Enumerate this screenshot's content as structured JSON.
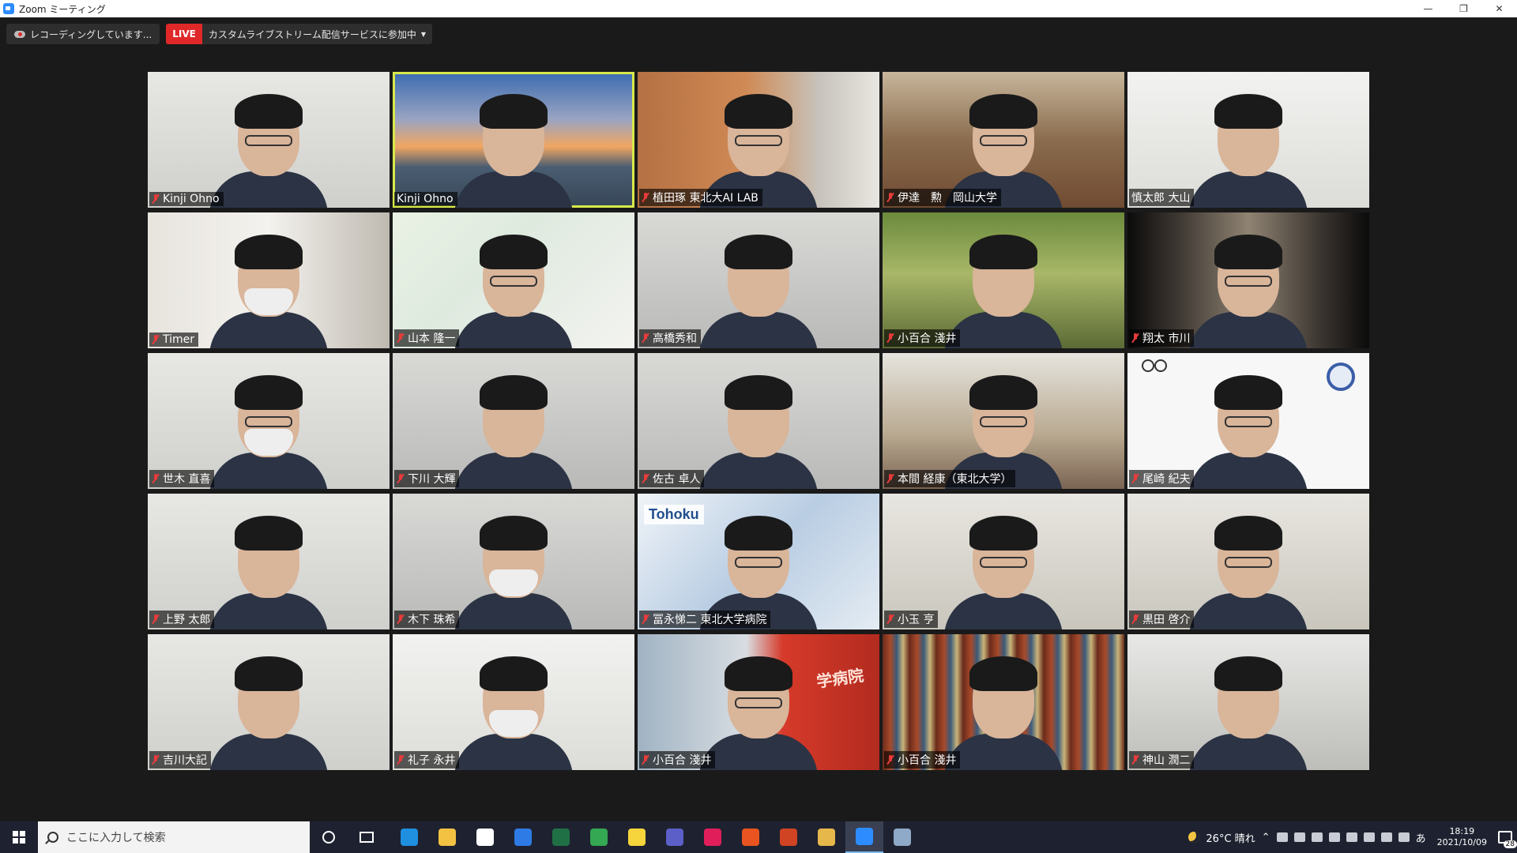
{
  "window": {
    "title": "Zoom ミーティング"
  },
  "topbar": {
    "recording_label": "レコーディングしています...",
    "live_badge": "LIVE",
    "live_label": "カスタムライブストリーム配信サービスに参加中"
  },
  "participants": [
    {
      "name": "Kinji Ohno",
      "bg": "bg-office-white",
      "muted": true,
      "glasses": true
    },
    {
      "name": "Kinji Ohno",
      "bg": "bg-bridge",
      "muted": false,
      "active": true
    },
    {
      "name": "植田琢 東北大AI LAB",
      "bg": "bg-orange-wall",
      "muted": true,
      "glasses": true
    },
    {
      "name": "伊達　勲　岡山大学",
      "bg": "bg-lecture",
      "muted": true,
      "glasses": true
    },
    {
      "name": "慎太郎 大山",
      "bg": "bg-white",
      "muted": false
    },
    {
      "name": "Timer",
      "bg": "bg-shelf",
      "muted": true,
      "mask": true
    },
    {
      "name": "山本 隆一",
      "bg": "bg-slide",
      "muted": true,
      "glasses": true
    },
    {
      "name": "高橋秀和",
      "bg": "bg-office-grey",
      "muted": true
    },
    {
      "name": "小百合 淺井",
      "bg": "bg-trees",
      "muted": true
    },
    {
      "name": "翔太 市川",
      "bg": "bg-bookshelf-dark",
      "muted": true,
      "glasses": true
    },
    {
      "name": "世木 直喜",
      "bg": "bg-office-white",
      "muted": true,
      "glasses": true,
      "mask": true
    },
    {
      "name": "下川 大輝",
      "bg": "bg-office-grey",
      "muted": true
    },
    {
      "name": "佐古 卓人",
      "bg": "bg-office-grey",
      "muted": true
    },
    {
      "name": "本間 経康（東北大学）",
      "bg": "bg-classroom",
      "muted": true,
      "glasses": true
    },
    {
      "name": "尾崎 紀夫",
      "bg": "bg-logo-white",
      "muted": true,
      "glasses": true,
      "logo": true
    },
    {
      "name": "上野 太郎",
      "bg": "bg-office-white",
      "muted": true
    },
    {
      "name": "木下 珠希",
      "bg": "bg-office-grey",
      "muted": true,
      "mask": true
    },
    {
      "name": "冨永悌二 東北大学病院",
      "bg": "bg-hospital",
      "muted": true,
      "glasses": true,
      "tohoku": true
    },
    {
      "name": "小玉 亨",
      "bg": "bg-office-light",
      "muted": true,
      "glasses": true
    },
    {
      "name": "黒田 啓介",
      "bg": "bg-office-light",
      "muted": true,
      "glasses": true
    },
    {
      "name": "吉川大記",
      "bg": "bg-office-white",
      "muted": true
    },
    {
      "name": "礼子 永井",
      "bg": "bg-white",
      "muted": true,
      "mask": true
    },
    {
      "name": "小百合 淺井",
      "bg": "bg-hospital-red",
      "muted": true,
      "glasses": true,
      "sign": true
    },
    {
      "name": "小百合 淺井",
      "bg": "bg-library",
      "muted": true
    },
    {
      "name": "神山 潤二",
      "bg": "bg-ceiling",
      "muted": true
    }
  ],
  "tohoku_logo": "Tohoku",
  "hospital_sign": "学病院",
  "taskbar": {
    "search_placeholder": "ここに入力して検索",
    "apps": [
      {
        "name": "edge-icon",
        "color": "#1f8fe0"
      },
      {
        "name": "file-explorer-icon",
        "color": "#f3c243"
      },
      {
        "name": "store-icon",
        "color": "#ffffff"
      },
      {
        "name": "mail-icon",
        "color": "#2f7be5"
      },
      {
        "name": "excel-icon",
        "color": "#1f7145"
      },
      {
        "name": "chrome-icon",
        "color": "#34a853"
      },
      {
        "name": "notes-icon",
        "color": "#f5d43c"
      },
      {
        "name": "teams-icon",
        "color": "#5b5fc7"
      },
      {
        "name": "slack-icon",
        "color": "#e01e5a"
      },
      {
        "name": "ubuntu-icon",
        "color": "#e95420"
      },
      {
        "name": "powerpoint-icon",
        "color": "#d04423"
      },
      {
        "name": "paint-icon",
        "color": "#e6b84c"
      },
      {
        "name": "zoom-icon",
        "color": "#2d8cff",
        "active": true
      },
      {
        "name": "misc-app-icon",
        "color": "#8fa9c8"
      }
    ],
    "weather": "26°C 晴れ",
    "ime": "あ",
    "time": "18:19",
    "date": "2021/10/09",
    "notifications": "28"
  }
}
